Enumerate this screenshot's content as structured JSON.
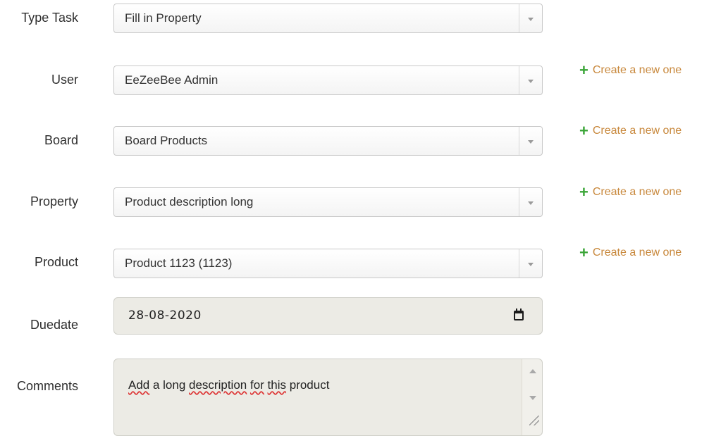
{
  "form": {
    "type_task": {
      "label": "Type Task",
      "value": "Fill in Property"
    },
    "user": {
      "label": "User",
      "value": "EeZeeBee Admin",
      "create_link": "Create a new one"
    },
    "board": {
      "label": "Board",
      "value": "Board Products",
      "create_link": "Create a new one"
    },
    "property": {
      "label": "Property",
      "value": "Product description long",
      "create_link": "Create a new one"
    },
    "product": {
      "label": "Product",
      "value": "Product 1123 (1123)",
      "create_link": "Create a new one"
    },
    "duedate": {
      "label": "Duedate",
      "value": "28-08-2020"
    },
    "comments": {
      "label": "Comments",
      "value_parts": [
        "Add",
        " a long ",
        "description",
        " ",
        "for",
        " ",
        "this",
        " product"
      ]
    }
  },
  "icons": {
    "create": "plus-icon",
    "select_arrow": "chevron-down-icon",
    "date": "calendar-icon"
  },
  "colors": {
    "link": "#c8883c",
    "plus": "#3aa537",
    "readonly_bg": "#ecebe5"
  }
}
